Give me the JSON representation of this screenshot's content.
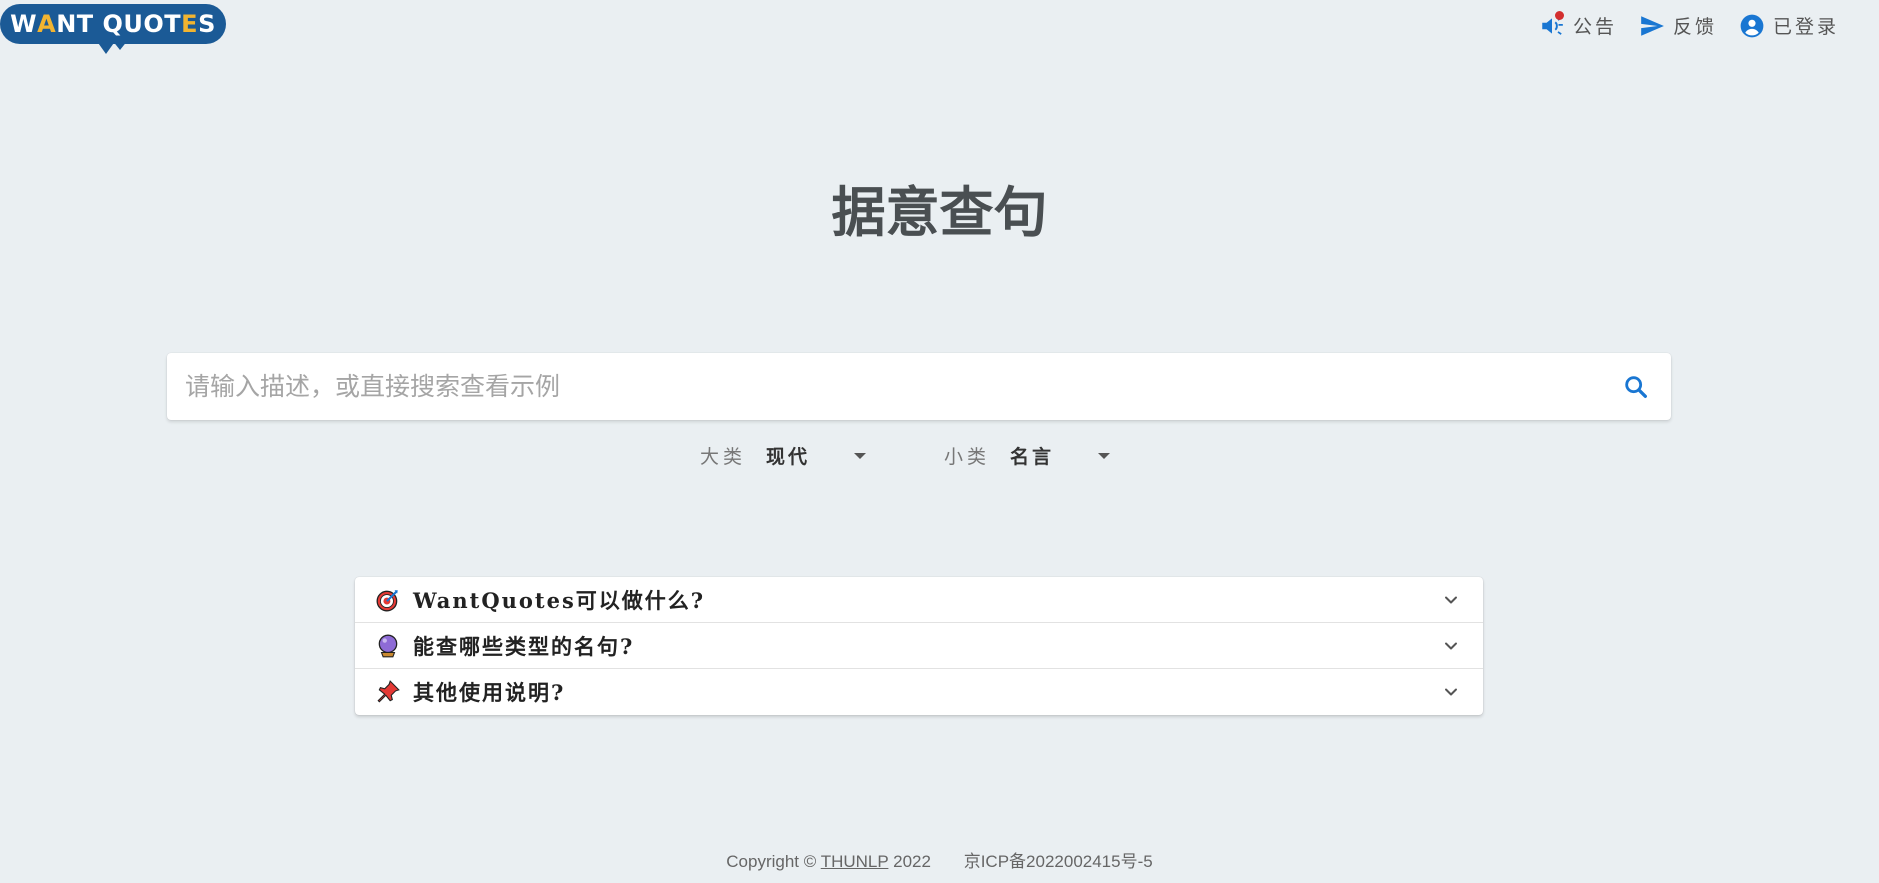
{
  "logo": {
    "part1": "W",
    "part2": "A",
    "part3": "NT QUOT",
    "part4": "E",
    "part5": "S"
  },
  "nav": {
    "announce": "公告",
    "feedback": "反馈",
    "login": "已登录"
  },
  "title": "据意查句",
  "search": {
    "placeholder": "请输入描述，或直接搜索查看示例",
    "value": ""
  },
  "filters": {
    "major_label": "大类",
    "major_value": "现代",
    "minor_label": "小类",
    "minor_value": "名言"
  },
  "faq": [
    {
      "icon": "target-icon",
      "title": "WantQuotes可以做什么?"
    },
    {
      "icon": "crystal-ball-icon",
      "title": "能查哪些类型的名句?"
    },
    {
      "icon": "pushpin-icon",
      "title": "其他使用说明?"
    }
  ],
  "footer": {
    "copyright_prefix": "Copyright ©",
    "org": "THUNLP",
    "year": "2022",
    "icp": "京ICP备2022002415号-5"
  },
  "colors": {
    "background": "#eaeff2",
    "accent_blue": "#1976d2",
    "logo_blue": "#1b5a96",
    "logo_yellow": "#f2b430",
    "notification_red": "#d32f2f"
  }
}
